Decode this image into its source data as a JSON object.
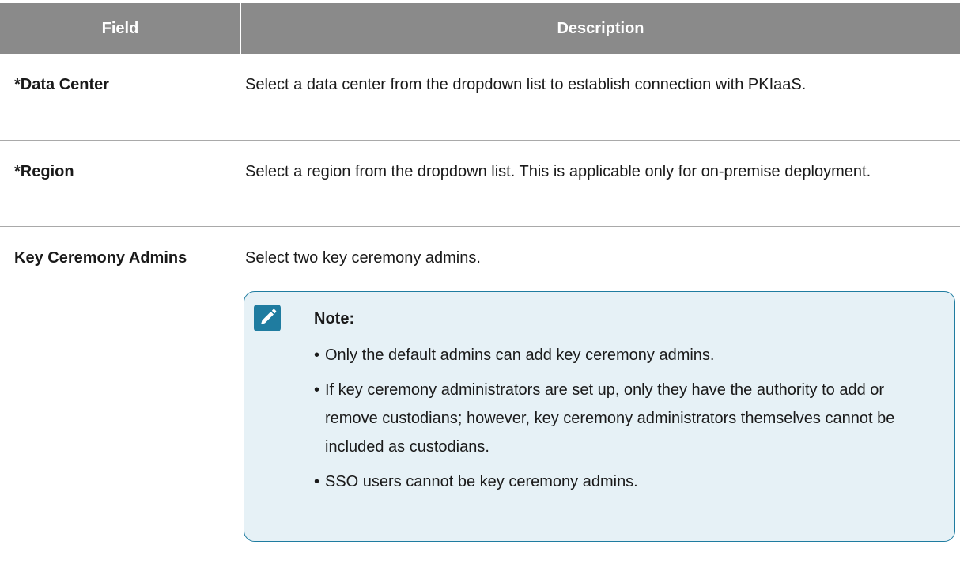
{
  "table": {
    "headers": {
      "field": "Field",
      "description": "Description"
    },
    "rows": [
      {
        "field": "*Data Center",
        "description": "Select a data center from the dropdown list to establish connection with PKIaaS."
      },
      {
        "field": "*Region",
        "description": "Select a region from the dropdown list. This is applicable only for on-premise deployment."
      },
      {
        "field": "Key Ceremony Admins",
        "description": "Select two key ceremony admins."
      }
    ]
  },
  "note": {
    "icon": "pencil-icon",
    "title": "Note:",
    "items": [
      "Only the default admins can add key ceremony admins.",
      "If key ceremony administrators are set up, only they have the authority to add or remove custodians; however, key ceremony administrators themselves cannot be included as custodians.",
      "SSO users cannot be key ceremony admins."
    ]
  },
  "colors": {
    "header_bg": "#8a8a8a",
    "note_bg": "#e6f1f6",
    "note_border": "#1f7ca0"
  }
}
